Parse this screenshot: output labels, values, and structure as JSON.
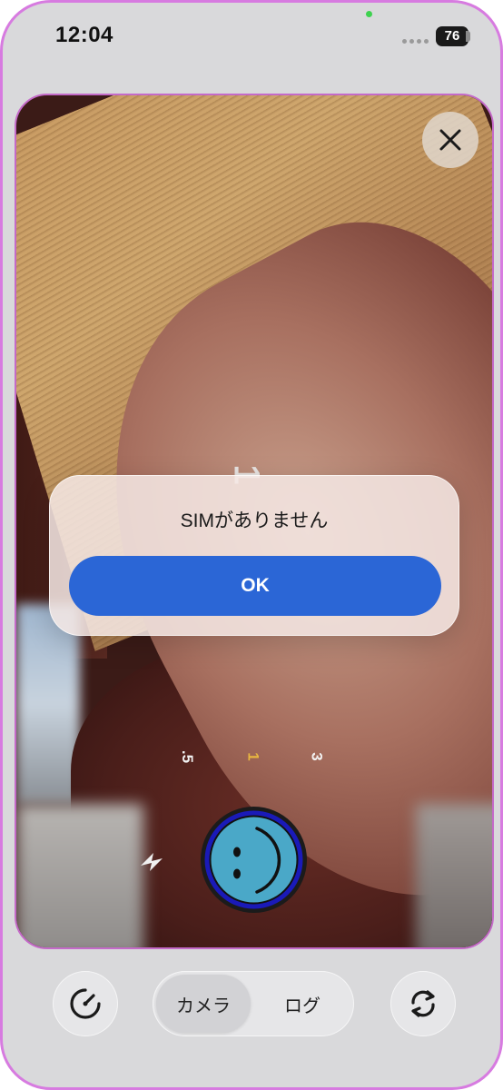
{
  "status_bar": {
    "time": "12:04",
    "battery": "76"
  },
  "camera": {
    "overlay_number": "1",
    "zoom_levels": [
      ".5",
      "1",
      "3"
    ],
    "active_zoom": "1",
    "close_icon": "close-icon",
    "flash_icon": "flash-icon",
    "shutter_icon": "smiley-shutter-icon"
  },
  "alert": {
    "message": "SIMがありません",
    "ok_label": "OK"
  },
  "toolbar": {
    "left_icon": "speedometer-icon",
    "right_icon": "switch-camera-icon",
    "segments": [
      {
        "label": "カメラ",
        "active": true
      },
      {
        "label": "ログ",
        "active": false
      }
    ]
  },
  "colors": {
    "accent": "#2b66d6",
    "device_border": "#d77be0",
    "active_zoom": "#e8b640",
    "shutter_face": "#4aa8c8",
    "shutter_ring": "#1a1ab8"
  }
}
